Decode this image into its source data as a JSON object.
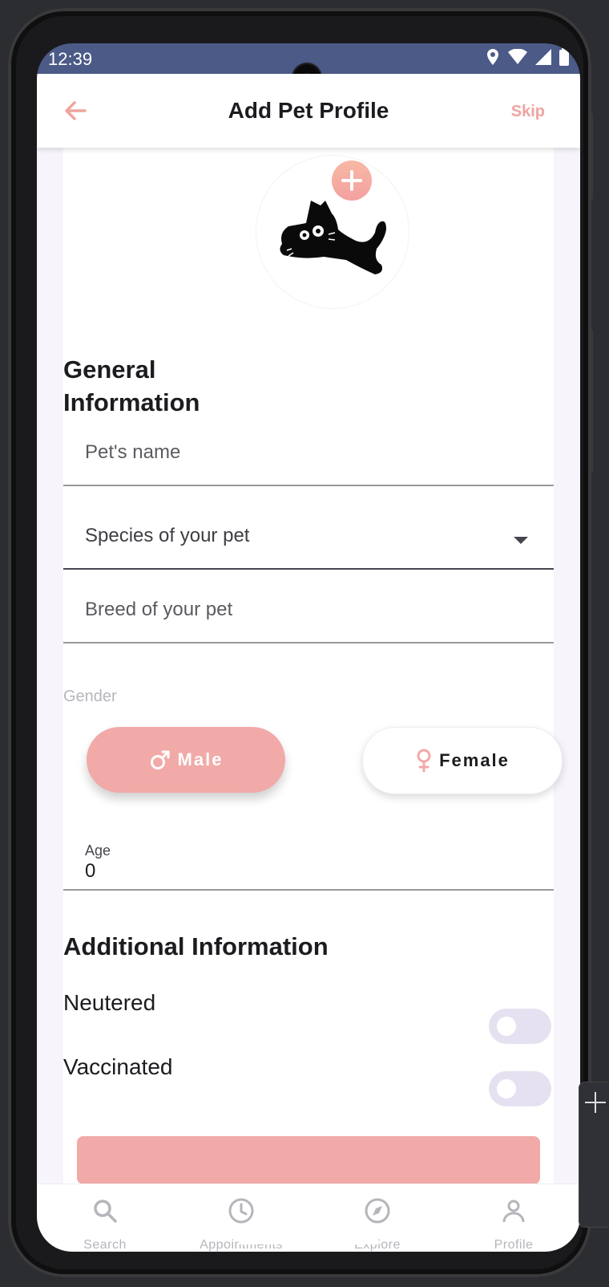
{
  "status_bar": {
    "time": "12:39"
  },
  "app_bar": {
    "title": "Add Pet Profile",
    "skip_label": "Skip"
  },
  "general": {
    "title_line1": "General",
    "title_line2": "Information",
    "pet_name_placeholder": "Pet's name",
    "species_placeholder": "Species of your pet",
    "breed_placeholder": "Breed of your pet",
    "gender_label": "Gender",
    "male_label": "Male",
    "female_label": "Female",
    "selected_gender": "Male",
    "age_label": "Age",
    "age_value": "0"
  },
  "additional": {
    "title": "Additional Information",
    "neutered_label": "Neutered",
    "neutered_on": false,
    "vaccinated_label": "Vaccinated",
    "vaccinated_on": false
  },
  "bottom_nav": [
    {
      "label": "Search",
      "icon": "search-icon"
    },
    {
      "label": "Appointments",
      "icon": "clock-icon"
    },
    {
      "label": "Explore",
      "icon": "compass-icon"
    },
    {
      "label": "Profile",
      "icon": "person-icon"
    }
  ],
  "colors": {
    "accent": "#f1aaa8",
    "status_bar": "#4b5a87",
    "toggle_track": "#e6e1f1",
    "nav_inactive": "#b5b5bb"
  }
}
